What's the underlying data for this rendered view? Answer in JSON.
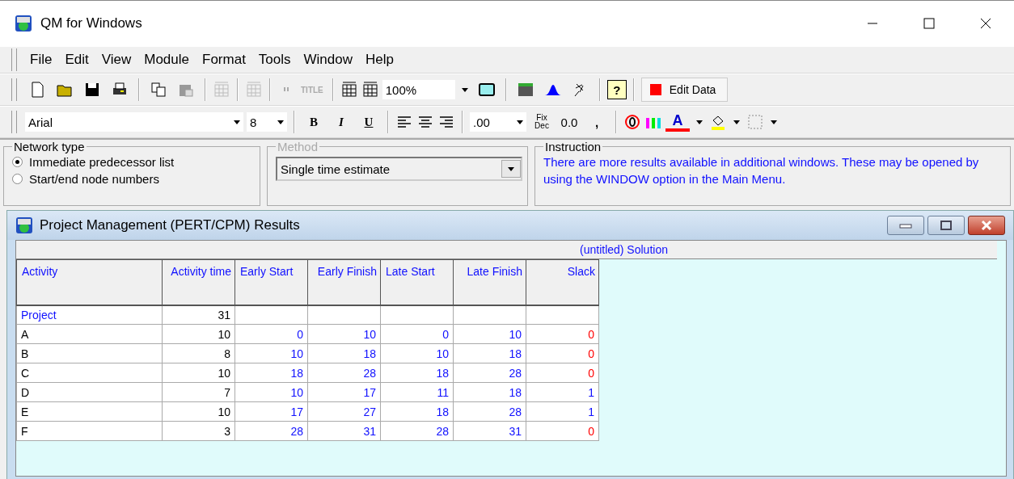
{
  "window": {
    "title": "QM for Windows"
  },
  "menu": [
    {
      "label": "File"
    },
    {
      "label": "Edit"
    },
    {
      "label": "View"
    },
    {
      "label": "Module"
    },
    {
      "label": "Format"
    },
    {
      "label": "Tools"
    },
    {
      "label": "Window"
    },
    {
      "label": "Help"
    }
  ],
  "toolbar": {
    "title_button": "TITLE",
    "zoom": "100%",
    "help": "?",
    "edit_data": "Edit Data"
  },
  "format_bar": {
    "font": "Arial",
    "size": "8",
    "bold": "B",
    "italic": "I",
    "underline": "U",
    "decimals": ".00",
    "fix_dec": "Fix Dec",
    "one_decimal": "0.0",
    "comma": ",",
    "font_color": "A"
  },
  "options": {
    "network_type": {
      "legend": "Network type",
      "choices": [
        {
          "label": "Immediate predecessor list",
          "selected": true
        },
        {
          "label": "Start/end node numbers",
          "selected": false
        }
      ]
    },
    "method": {
      "legend": "Method",
      "disabled": true,
      "value": "Single time estimate"
    },
    "instruction": {
      "legend": "Instruction",
      "text": "There are more results available in additional windows. These may be opened by using the WINDOW option in the Main Menu."
    }
  },
  "results": {
    "title": "Project Management (PERT/CPM) Results",
    "caption": "(untitled) Solution",
    "columns": [
      "Activity",
      "Activity time",
      "Early Start",
      "Early Finish",
      "Late Start",
      "Late Finish",
      "Slack"
    ],
    "rows": [
      {
        "kind": "summary",
        "cells": [
          "Project",
          "31",
          "",
          "",
          "",
          "",
          ""
        ]
      },
      {
        "kind": "activity",
        "critical": true,
        "cells": [
          "A",
          "10",
          "0",
          "10",
          "0",
          "10",
          "0"
        ]
      },
      {
        "kind": "activity",
        "critical": true,
        "cells": [
          "B",
          "8",
          "10",
          "18",
          "10",
          "18",
          "0"
        ]
      },
      {
        "kind": "activity",
        "critical": true,
        "cells": [
          "C",
          "10",
          "18",
          "28",
          "18",
          "28",
          "0"
        ]
      },
      {
        "kind": "activity",
        "critical": false,
        "cells": [
          "D",
          "7",
          "10",
          "17",
          "11",
          "18",
          "1"
        ]
      },
      {
        "kind": "activity",
        "critical": false,
        "cells": [
          "E",
          "10",
          "17",
          "27",
          "18",
          "28",
          "1"
        ]
      },
      {
        "kind": "activity",
        "critical": true,
        "cells": [
          "F",
          "3",
          "28",
          "31",
          "28",
          "31",
          "0"
        ]
      }
    ]
  }
}
